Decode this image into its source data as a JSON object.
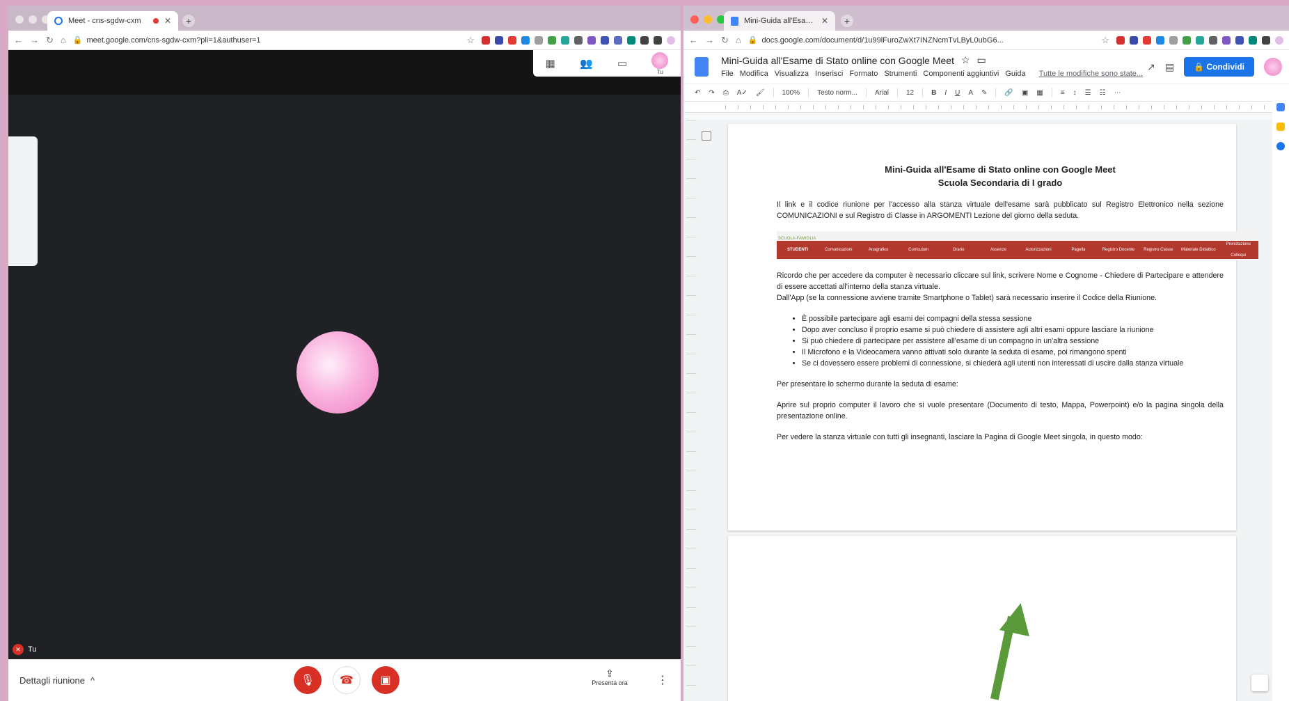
{
  "meet": {
    "tab_title": "Meet - cns-sgdw-cxm",
    "url": "meet.google.com/cns-sgdw-cxm?pli=1&authuser=1",
    "self_label": "Tu",
    "top_self": "Tu",
    "details_label": "Dettagli riunione",
    "present_label": "Presenta ora"
  },
  "docs": {
    "tab_title": "Mini-Guida all'Esame di Stato",
    "url": "docs.google.com/document/d/1u99lFuroZwXt7INZNcmTvLByL0ubG6...",
    "doc_title": "Mini-Guida all'Esame di Stato online con Google Meet",
    "menu": [
      "File",
      "Modifica",
      "Visualizza",
      "Inserisci",
      "Formato",
      "Strumenti",
      "Componenti aggiuntivi",
      "Guida"
    ],
    "saved": "Tutte le modifiche sono state...",
    "share": "Condividi",
    "toolbar": {
      "zoom": "100%",
      "style": "Testo norm...",
      "font": "Arial",
      "size": "12"
    },
    "heading1": "Mini-Guida all'Esame di Stato online con Google Meet",
    "heading2": "Scuola Secondaria di I grado",
    "p1": "Il link e il codice riunione per l'accesso alla stanza virtuale dell'esame sarà pubblicato sul Registro Elettronico nella sezione COMUNICAZIONI e sul Registro di Classe in ARGOMENTI Lezione del giorno della seduta.",
    "banner": {
      "brand": "SCUOLA-FAMIGLIA",
      "students": "STUDENTI",
      "items": [
        "Comunicazioni",
        "Anagrafico",
        "Curriculum",
        "Orario",
        "Assenze",
        "Autorizzazioni",
        "Pagella",
        "Registro Docente",
        "Registro Classe",
        "Materiale Didattico",
        "Prenotazione Colloqui"
      ]
    },
    "p2": "Ricordo che per accedere da computer è necessario cliccare sul link, scrivere Nome e Cognome - Chiedere di Partecipare e attendere di essere accettati all'interno della stanza virtuale.",
    "p3": "Dall'App (se la connessione avviene tramite Smartphone o Tablet) sarà necessario inserire il Codice della Riunione.",
    "bullets": [
      "È possibile partecipare agli esami dei compagni della stessa sessione",
      "Dopo aver concluso il proprio esame si può chiedere  di assistere agli altri esami oppure lasciare la riunione",
      "Si può chiedere di partecipare per assistere all'esame di un compagno in un'altra sessione",
      "Il Microfono e la Videocamera vanno attivati solo durante la seduta di esame, poi rimangono spenti",
      "Se ci dovessero essere problemi di connessione, si chiederà agli utenti non interessati di uscire dalla stanza virtuale"
    ],
    "p4": "Per presentare lo schermo durante la seduta di esame:",
    "p5": "Aprire sul proprio computer il lavoro che si vuole presentare (Documento di testo, Mappa, Powerpoint) e/o la pagina singola della presentazione online.",
    "p6": "Per vedere la stanza virtuale con tutti gli insegnanti, lasciare la Pagina di Google Meet singola, in questo modo:"
  }
}
